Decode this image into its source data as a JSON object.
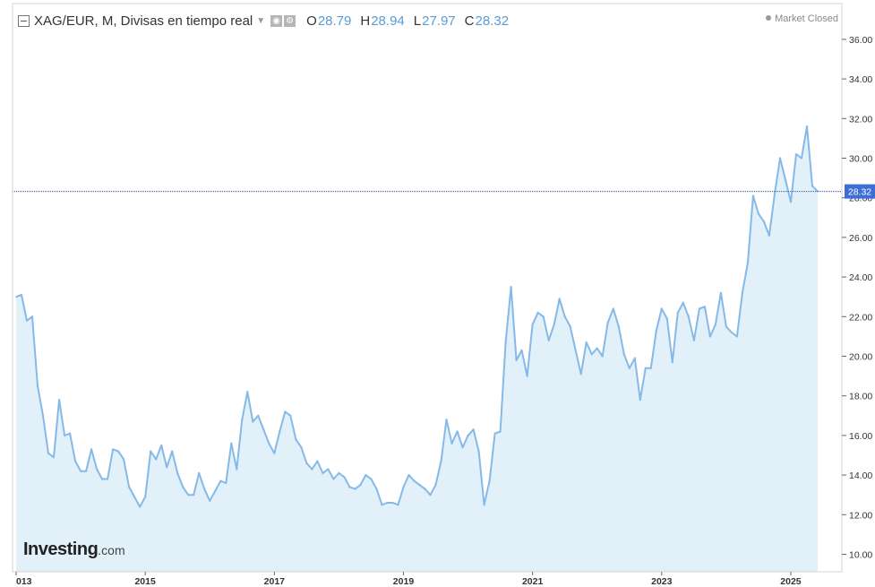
{
  "header": {
    "title": "XAG/EUR, M, Divisas en tiempo real",
    "ohlc": [
      {
        "label": "O",
        "value": "28.79"
      },
      {
        "label": "H",
        "value": "28.94"
      },
      {
        "label": "L",
        "value": "27.97"
      },
      {
        "label": "C",
        "value": "28.32"
      }
    ],
    "market_status": "Market Closed"
  },
  "logo": {
    "main": "Investing",
    "suffix": ".com"
  },
  "colors": {
    "line": "#85b9e8",
    "fill": "#e2f0fa",
    "last_price_line": "#2a4fa8",
    "last_price_badge": "#3b6fd6"
  },
  "chart_data": {
    "type": "area",
    "title": "XAG/EUR, M, Divisas en tiempo real",
    "xlabel": "",
    "ylabel": "",
    "x_range": [
      "2013-01",
      "2025-05"
    ],
    "ylim": [
      9,
      37
    ],
    "y_ticks": [
      "10.00",
      "12.00",
      "14.00",
      "16.00",
      "18.00",
      "20.00",
      "22.00",
      "24.00",
      "26.00",
      "28.00",
      "30.00",
      "32.00",
      "34.00",
      "36.00"
    ],
    "x_ticks": [
      {
        "date": "2013-01",
        "label": "013"
      },
      {
        "date": "2015-01",
        "label": "2015"
      },
      {
        "date": "2017-01",
        "label": "2017"
      },
      {
        "date": "2019-01",
        "label": "2019"
      },
      {
        "date": "2021-01",
        "label": "2021"
      },
      {
        "date": "2023-01",
        "label": "2023"
      },
      {
        "date": "2025-01",
        "label": "2025"
      }
    ],
    "last_price": "28.32",
    "grid": false,
    "series": [
      {
        "points": [
          [
            "2013-01",
            23.0
          ],
          [
            "2013-02",
            23.1
          ],
          [
            "2013-03",
            21.8
          ],
          [
            "2013-04",
            22.0
          ],
          [
            "2013-05",
            18.5
          ],
          [
            "2013-06",
            17.0
          ],
          [
            "2013-07",
            15.1
          ],
          [
            "2013-08",
            14.9
          ],
          [
            "2013-09",
            17.8
          ],
          [
            "2013-10",
            16.0
          ],
          [
            "2013-11",
            16.1
          ],
          [
            "2013-12",
            14.7
          ],
          [
            "2014-01",
            14.2
          ],
          [
            "2014-02",
            14.2
          ],
          [
            "2014-03",
            15.3
          ],
          [
            "2014-04",
            14.3
          ],
          [
            "2014-05",
            13.8
          ],
          [
            "2014-06",
            13.8
          ],
          [
            "2014-07",
            15.3
          ],
          [
            "2014-08",
            15.2
          ],
          [
            "2014-09",
            14.8
          ],
          [
            "2014-10",
            13.4
          ],
          [
            "2014-11",
            12.9
          ],
          [
            "2014-12",
            12.4
          ],
          [
            "2015-01",
            12.9
          ],
          [
            "2015-02",
            15.2
          ],
          [
            "2015-03",
            14.8
          ],
          [
            "2015-04",
            15.5
          ],
          [
            "2015-05",
            14.4
          ],
          [
            "2015-06",
            15.2
          ],
          [
            "2015-07",
            14.1
          ],
          [
            "2015-08",
            13.4
          ],
          [
            "2015-09",
            13.0
          ],
          [
            "2015-10",
            13.0
          ],
          [
            "2015-11",
            14.1
          ],
          [
            "2015-12",
            13.3
          ],
          [
            "2016-01",
            12.7
          ],
          [
            "2016-02",
            13.2
          ],
          [
            "2016-03",
            13.7
          ],
          [
            "2016-04",
            13.6
          ],
          [
            "2016-05",
            15.6
          ],
          [
            "2016-06",
            14.3
          ],
          [
            "2016-07",
            16.8
          ],
          [
            "2016-08",
            18.2
          ],
          [
            "2016-09",
            16.7
          ],
          [
            "2016-10",
            17.0
          ],
          [
            "2016-11",
            16.3
          ],
          [
            "2016-12",
            15.6
          ],
          [
            "2017-01",
            15.1
          ],
          [
            "2017-02",
            16.2
          ],
          [
            "2017-03",
            17.2
          ],
          [
            "2017-04",
            17.0
          ],
          [
            "2017-05",
            15.8
          ],
          [
            "2017-06",
            15.4
          ],
          [
            "2017-07",
            14.6
          ],
          [
            "2017-08",
            14.3
          ],
          [
            "2017-09",
            14.7
          ],
          [
            "2017-10",
            14.1
          ],
          [
            "2017-11",
            14.3
          ],
          [
            "2017-12",
            13.8
          ],
          [
            "2018-01",
            14.1
          ],
          [
            "2018-02",
            13.9
          ],
          [
            "2018-03",
            13.4
          ],
          [
            "2018-04",
            13.3
          ],
          [
            "2018-05",
            13.5
          ],
          [
            "2018-06",
            14.0
          ],
          [
            "2018-07",
            13.8
          ],
          [
            "2018-08",
            13.3
          ],
          [
            "2018-09",
            12.5
          ],
          [
            "2018-10",
            12.6
          ],
          [
            "2018-11",
            12.6
          ],
          [
            "2018-12",
            12.5
          ],
          [
            "2019-01",
            13.4
          ],
          [
            "2019-02",
            14.0
          ],
          [
            "2019-03",
            13.7
          ],
          [
            "2019-04",
            13.5
          ],
          [
            "2019-05",
            13.3
          ],
          [
            "2019-06",
            13.0
          ],
          [
            "2019-07",
            13.5
          ],
          [
            "2019-08",
            14.7
          ],
          [
            "2019-09",
            16.8
          ],
          [
            "2019-10",
            15.6
          ],
          [
            "2019-11",
            16.2
          ],
          [
            "2019-12",
            15.4
          ],
          [
            "2020-01",
            16.0
          ],
          [
            "2020-02",
            16.3
          ],
          [
            "2020-03",
            15.2
          ],
          [
            "2020-04",
            12.5
          ],
          [
            "2020-05",
            13.7
          ],
          [
            "2020-06",
            16.1
          ],
          [
            "2020-07",
            16.2
          ],
          [
            "2020-08",
            20.7
          ],
          [
            "2020-09",
            23.5
          ],
          [
            "2020-10",
            19.8
          ],
          [
            "2020-11",
            20.3
          ],
          [
            "2020-12",
            19.0
          ],
          [
            "2021-01",
            21.6
          ],
          [
            "2021-02",
            22.2
          ],
          [
            "2021-03",
            22.0
          ],
          [
            "2021-04",
            20.8
          ],
          [
            "2021-05",
            21.6
          ],
          [
            "2021-06",
            22.9
          ],
          [
            "2021-07",
            22.0
          ],
          [
            "2021-08",
            21.5
          ],
          [
            "2021-09",
            20.3
          ],
          [
            "2021-10",
            19.1
          ],
          [
            "2021-11",
            20.7
          ],
          [
            "2021-12",
            20.1
          ],
          [
            "2022-01",
            20.4
          ],
          [
            "2022-02",
            20.0
          ],
          [
            "2022-03",
            21.7
          ],
          [
            "2022-04",
            22.4
          ],
          [
            "2022-05",
            21.5
          ],
          [
            "2022-06",
            20.1
          ],
          [
            "2022-07",
            19.4
          ],
          [
            "2022-08",
            19.9
          ],
          [
            "2022-09",
            17.8
          ],
          [
            "2022-10",
            19.4
          ],
          [
            "2022-11",
            19.4
          ],
          [
            "2022-12",
            21.3
          ],
          [
            "2023-01",
            22.4
          ],
          [
            "2023-02",
            21.9
          ],
          [
            "2023-03",
            19.7
          ],
          [
            "2023-04",
            22.2
          ],
          [
            "2023-05",
            22.7
          ],
          [
            "2023-06",
            22.0
          ],
          [
            "2023-07",
            20.8
          ],
          [
            "2023-08",
            22.4
          ],
          [
            "2023-09",
            22.5
          ],
          [
            "2023-10",
            21.0
          ],
          [
            "2023-11",
            21.6
          ],
          [
            "2023-12",
            23.2
          ],
          [
            "2024-01",
            21.5
          ],
          [
            "2024-02",
            21.2
          ],
          [
            "2024-03",
            21.0
          ],
          [
            "2024-04",
            23.2
          ],
          [
            "2024-05",
            24.7
          ],
          [
            "2024-06",
            28.1
          ],
          [
            "2024-07",
            27.2
          ],
          [
            "2024-08",
            26.8
          ],
          [
            "2024-09",
            26.1
          ],
          [
            "2024-10",
            28.2
          ],
          [
            "2024-11",
            30.0
          ],
          [
            "2024-12",
            28.9
          ],
          [
            "2025-01",
            27.8
          ],
          [
            "2025-02",
            30.2
          ],
          [
            "2025-03",
            30.0
          ],
          [
            "2025-04",
            31.6
          ],
          [
            "2025-05",
            28.6
          ],
          [
            "2025-06",
            28.32
          ]
        ]
      }
    ]
  }
}
